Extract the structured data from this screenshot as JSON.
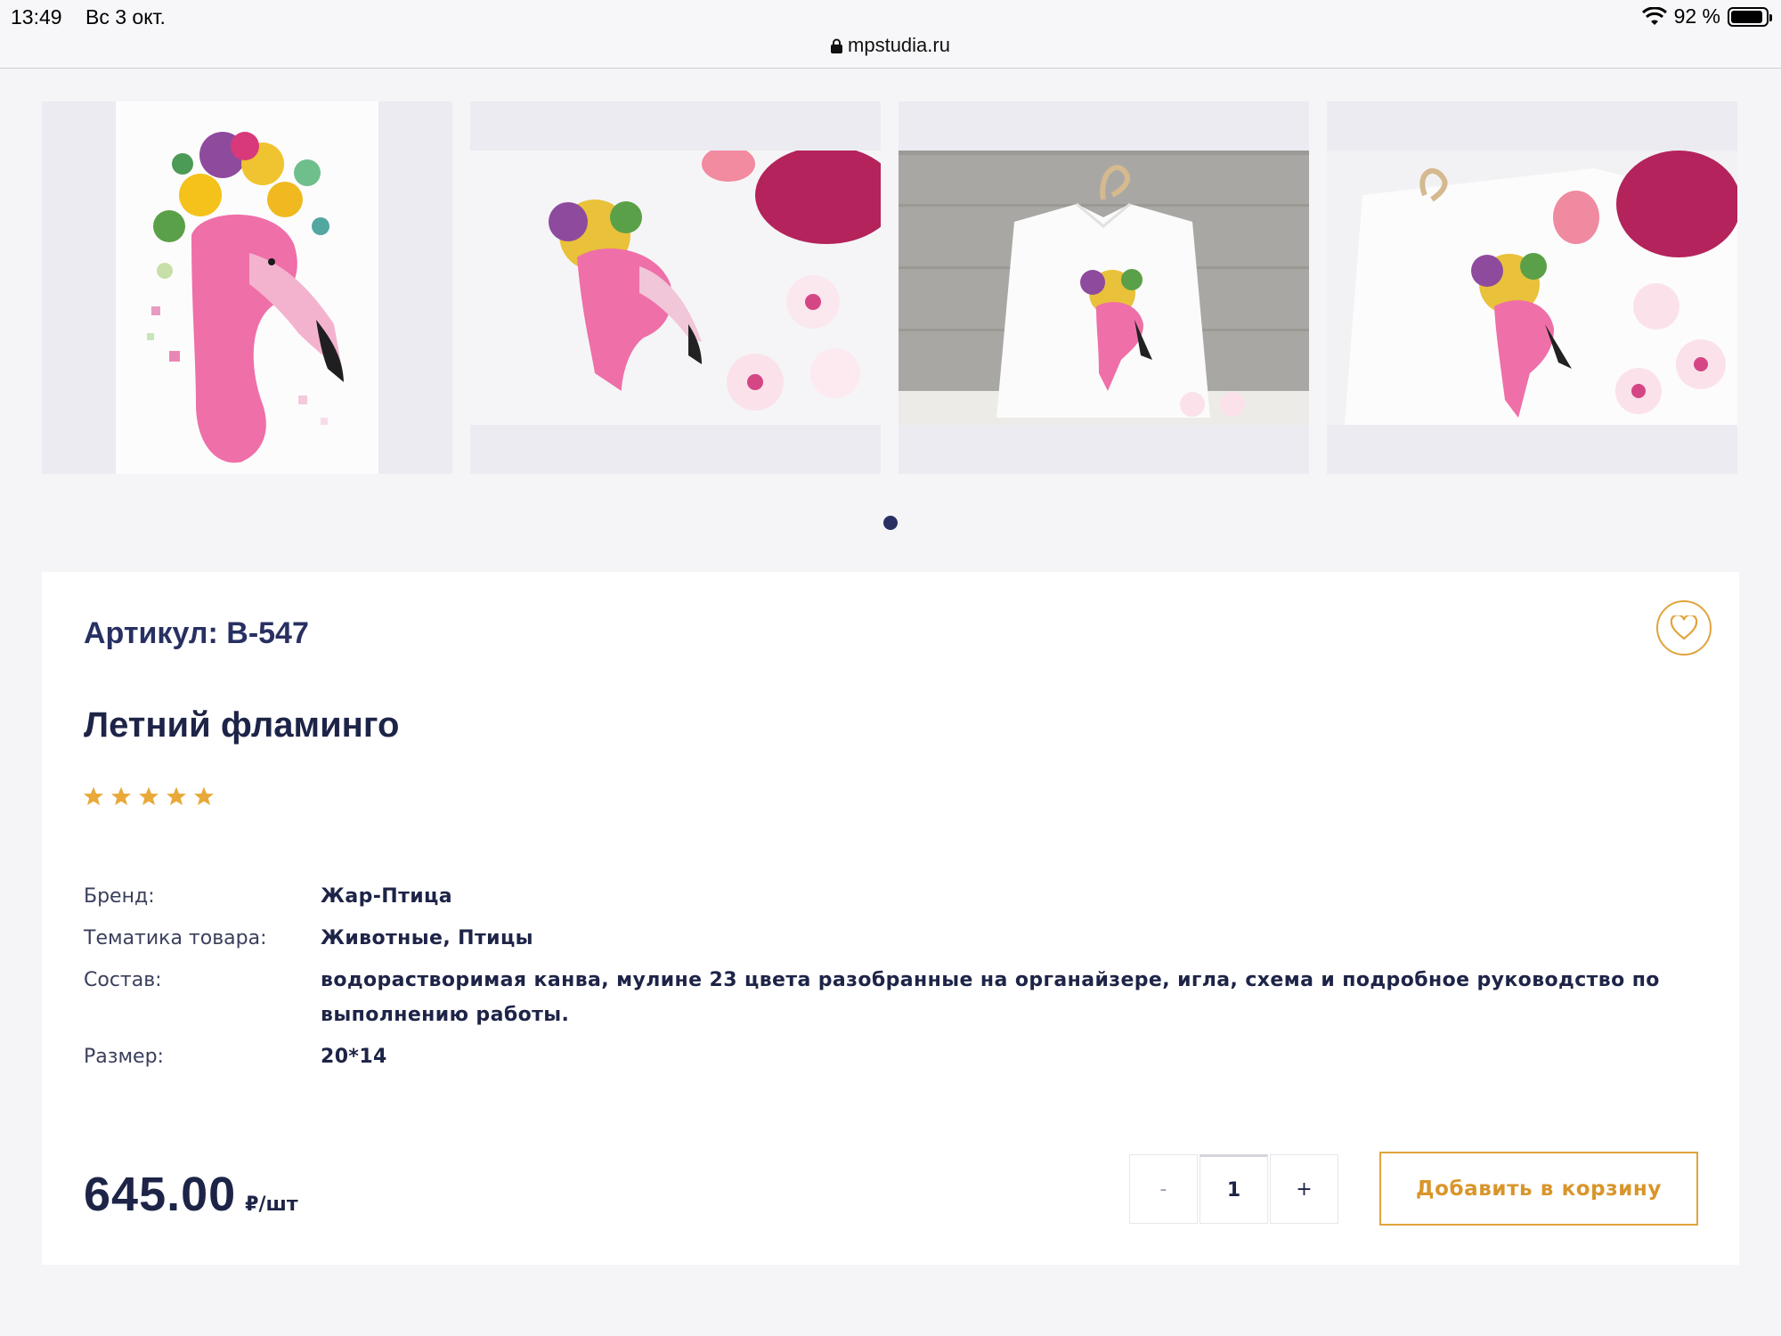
{
  "status_bar": {
    "time": "13:49",
    "date": "Вс 3 окт.",
    "battery": "92 %",
    "url": "mpstudia.ru"
  },
  "gallery": {
    "active_slide": 1,
    "slides": [
      {
        "image": "flamingo-cross-stitch-chart"
      },
      {
        "image": "flamingo-embroidery-on-white-cloth-with-flowers"
      },
      {
        "image": "flamingo-embroidery-on-shirt-on-hanger"
      },
      {
        "image": "flamingo-embroidery-on-shirt-with-orchids"
      }
    ]
  },
  "product": {
    "sku": "Артикул: B-547",
    "title": "Летний фламинго",
    "rating": 5,
    "rating_max": 5,
    "specs": [
      {
        "label": "Бренд:",
        "value": "Жар-Птица"
      },
      {
        "label": "Тематика товара:",
        "value": "Животные, Птицы"
      },
      {
        "label": "Состав:",
        "value": "водорастворимая канва, мулине 23 цвета разобранные на органайзере, игла, схема и подробное руководство по выполнению работы."
      },
      {
        "label": "Размер:",
        "value": "20*14"
      }
    ],
    "price": "645.00",
    "price_unit": "₽/шт",
    "quantity": "1",
    "minus_label": "-",
    "plus_label": "+",
    "add_to_cart_label": "Добавить в корзину"
  },
  "colors": {
    "accent": "#e0a43c",
    "primary": "#283062",
    "background": "#f5f5f8"
  }
}
